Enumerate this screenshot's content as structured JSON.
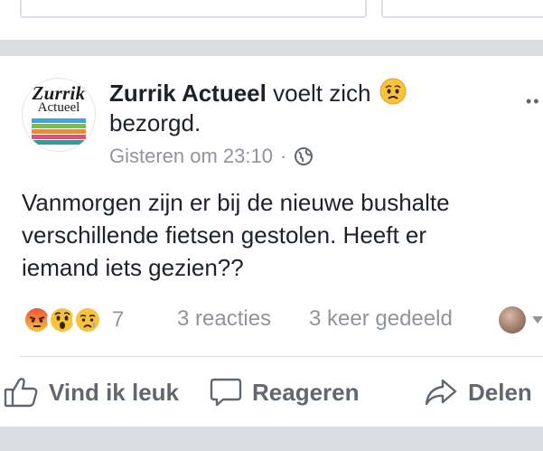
{
  "post": {
    "page_name": "Zurrik Actueel",
    "feeling_text": "voelt zich",
    "feeling_word": "bezorgd.",
    "feeling_icon": "worried-face-icon",
    "timestamp": "Gisteren om 23:10",
    "separator": "·",
    "audience_icon": "globe-icon",
    "more_label": "••",
    "body_lines": [
      "Vanmorgen zijn er bij de nieuwe bushalte",
      "verschillende fietsen gestolen. Heeft er",
      "iemand iets gezien??"
    ],
    "avatar": {
      "logo_line1": "Zurrik",
      "logo_line2": "Actueel",
      "stripe_colors": [
        "#3aa8d8",
        "#7ac143",
        "#f28c28",
        "#e94e77",
        "#2b9e9e"
      ]
    }
  },
  "stats": {
    "reaction_icons": [
      "angry-reaction-icon",
      "wow-reaction-icon",
      "sad-reaction-icon"
    ],
    "reaction_count": "7",
    "comments": "3 reacties",
    "shares": "3 keer gedeeld"
  },
  "actions": {
    "like": "Vind ik leuk",
    "comment": "Reageren",
    "share": "Delen"
  },
  "colors": {
    "text_primary": "#1d2129",
    "text_secondary": "#90949c",
    "action_gray": "#606770",
    "separator_bar": "#dadde1"
  }
}
